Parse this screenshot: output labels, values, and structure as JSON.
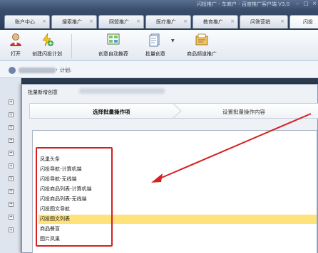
{
  "window": {
    "title": "闪投推广 - 车商户 - 百度推广客户端 V3.0"
  },
  "tabs": [
    {
      "label": "账户中心"
    },
    {
      "label": "搜索推广"
    },
    {
      "label": "网盟推广"
    },
    {
      "label": "医疗推广"
    },
    {
      "label": "教育推广"
    },
    {
      "label": "问答营销"
    },
    {
      "label": "闪投"
    }
  ],
  "toolbar": {
    "open": "打开",
    "create_plan": "创建闪投计划",
    "auto_recommend": "创意自动推荐",
    "batch_create": "批量创意",
    "product_promo": "商品频道推广"
  },
  "account": {
    "plan_label": "计划:"
  },
  "dialog": {
    "title": "批量新增创意",
    "step1": "选择批量操作项",
    "step2": "设置批量操作内容",
    "items": [
      "凤巢头条",
      "闪投导航-计算机端",
      "闪投导航-无线端",
      "闪投商品列表-计算机端",
      "闪投商品列表-无线端",
      "闪投图文导航",
      "闪投图文列表",
      "商品餐盲",
      "图片凤巢"
    ],
    "selected_index": 6
  },
  "colors": {
    "highlight": "#ffe27a",
    "annotation": "#d42020"
  }
}
